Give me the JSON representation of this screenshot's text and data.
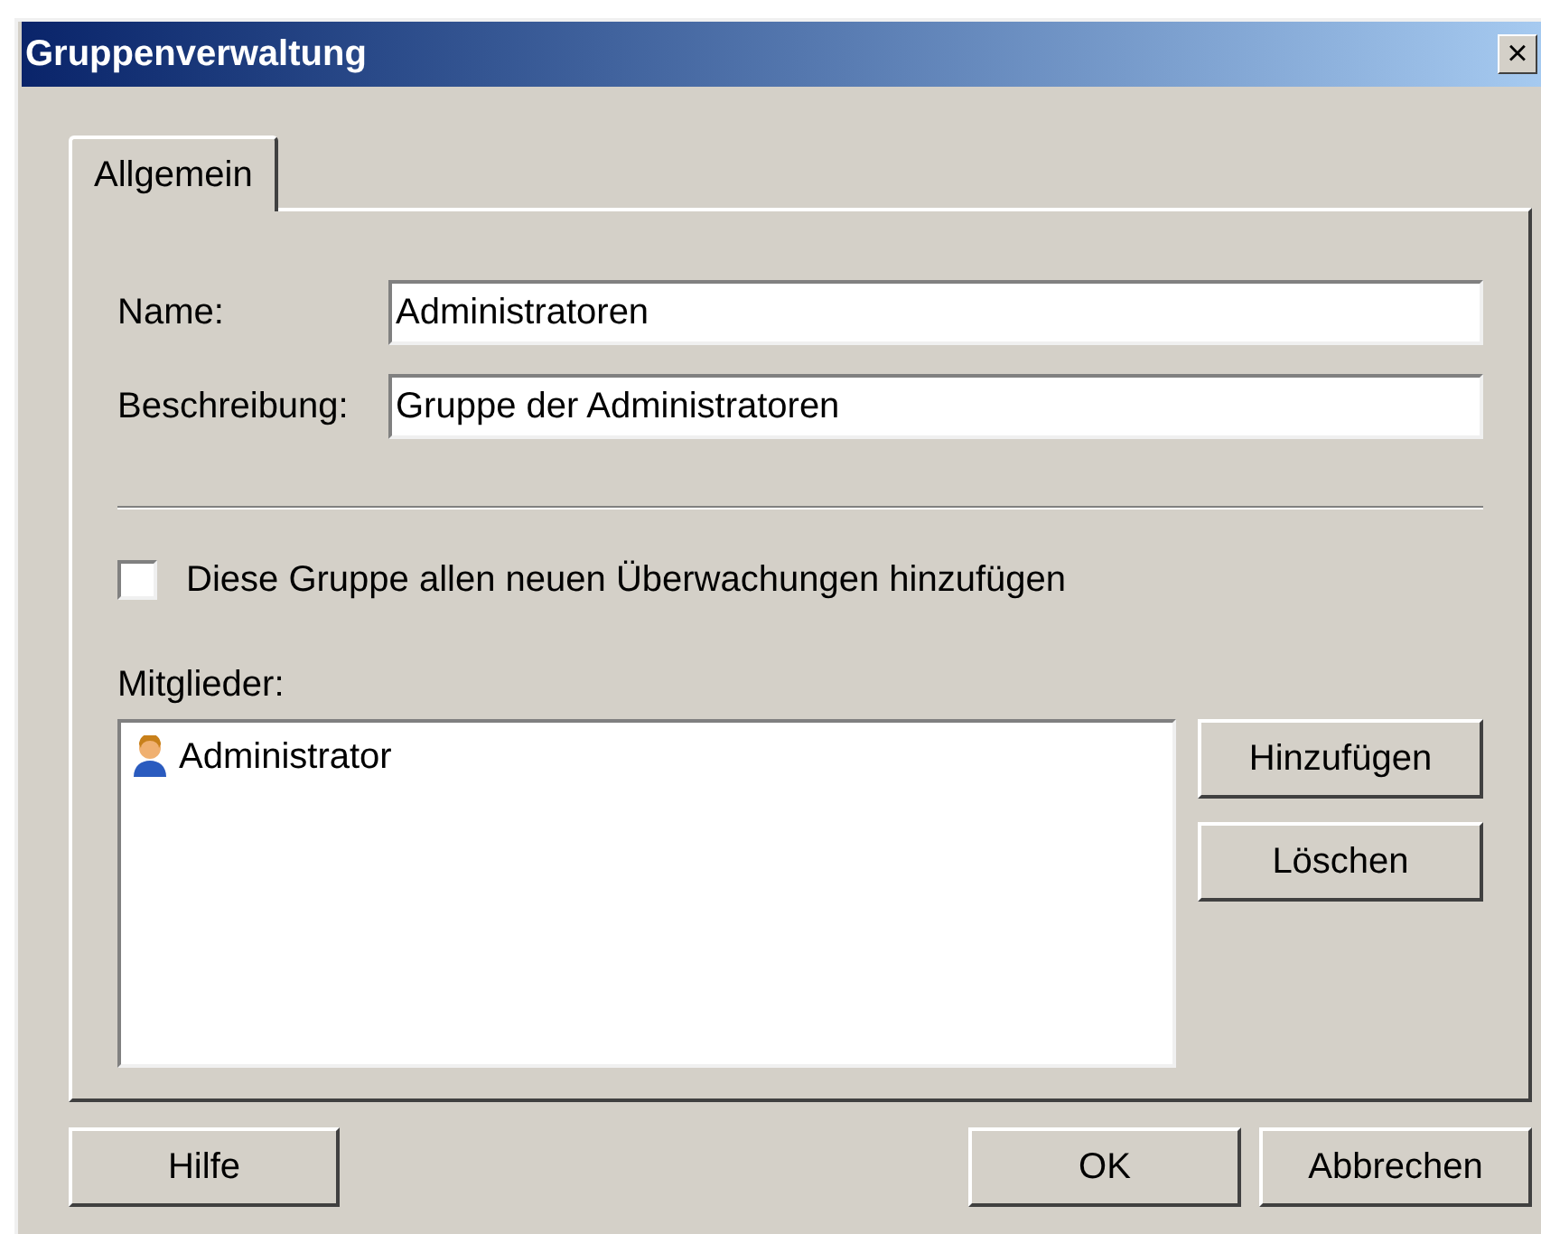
{
  "window": {
    "title": "Gruppenverwaltung",
    "close": "×"
  },
  "tabs": [
    {
      "label": "Allgemein",
      "selected": true
    }
  ],
  "fields": [
    {
      "label": "Name:",
      "value": "Administratoren"
    },
    {
      "label": "Beschreibung:",
      "value": "Gruppe der Administratoren"
    }
  ],
  "checkbox": {
    "label": "Diese Gruppe allen neuen Überwachungen hinzufügen",
    "checked": false
  },
  "members": {
    "label": "Mitglieder:",
    "items": [
      {
        "name": "Administrator",
        "selected": false
      }
    ]
  },
  "member_buttons": [
    "Hinzufügen",
    "Löschen"
  ],
  "footer": {
    "left": [
      "Hilfe"
    ],
    "right": [
      "OK",
      "Abbrechen"
    ]
  }
}
